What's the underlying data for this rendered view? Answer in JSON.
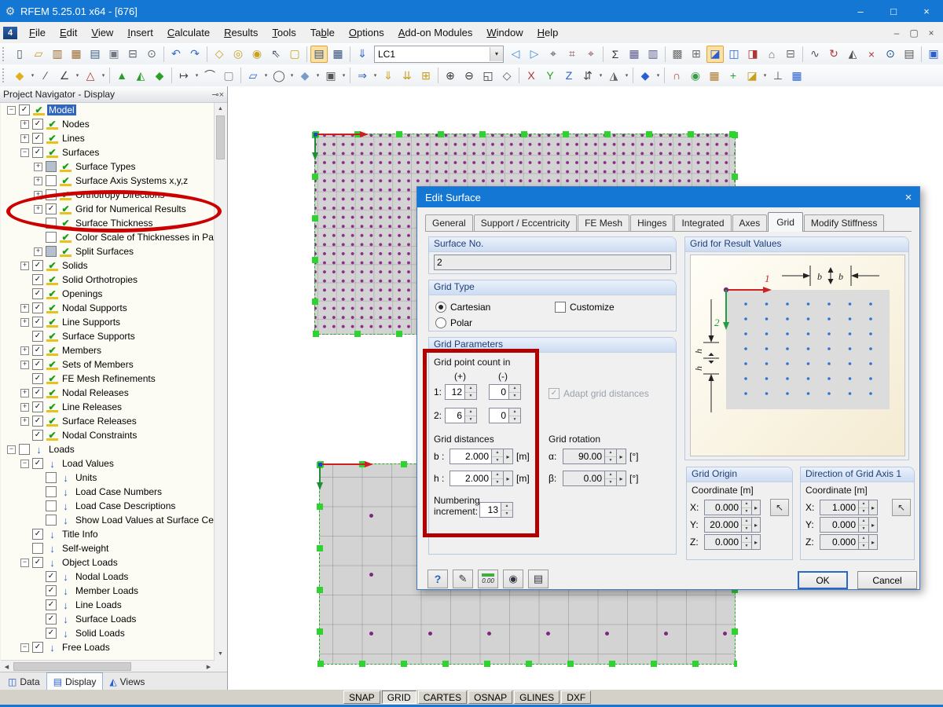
{
  "titlebar": {
    "title": "RFEM 5.25.01 x64 - [676]",
    "controls": [
      {
        "g": "–",
        "n": "minimize-button"
      },
      {
        "g": "□",
        "n": "maximize-button"
      },
      {
        "g": "×",
        "n": "close-button"
      }
    ]
  },
  "menubar": {
    "items": [
      {
        "label": "File",
        "u": 0
      },
      {
        "label": "Edit",
        "u": 0
      },
      {
        "label": "View",
        "u": 0
      },
      {
        "label": "Insert",
        "u": 0
      },
      {
        "label": "Calculate",
        "u": 0
      },
      {
        "label": "Results",
        "u": 0
      },
      {
        "label": "Tools",
        "u": 0
      },
      {
        "label": "Table",
        "u": 2
      },
      {
        "label": "Options",
        "u": 0
      },
      {
        "label": "Add-on Modules",
        "u": 0
      },
      {
        "label": "Window",
        "u": 0
      },
      {
        "label": "Help",
        "u": 0
      }
    ],
    "mdi_controls": [
      {
        "g": "–",
        "n": "mdi-minimize-button"
      },
      {
        "g": "▢",
        "n": "mdi-restore-button"
      },
      {
        "g": "×",
        "n": "mdi-close-button"
      }
    ]
  },
  "toolbar1": {
    "load_case": "LC1",
    "items_before": [
      "handle",
      [
        "▯",
        "new-file-icon",
        "#50565e"
      ],
      [
        "▱",
        "open-icon",
        "#c89a30"
      ],
      [
        "▥",
        "import-icon",
        "#9a6a30"
      ],
      [
        "▦",
        "export-icon",
        "#9a6a30"
      ],
      [
        "▤",
        "save-icon",
        "#3a5a86"
      ],
      [
        "▣",
        "clipboard-icon",
        "#707a86"
      ],
      [
        "⊟",
        "print-icon",
        "#5a6470"
      ],
      [
        "⊙",
        "print-preview-icon",
        "#5a6470"
      ],
      "sep",
      [
        "↶",
        "undo-icon",
        "#2f6cc4"
      ],
      [
        "↷",
        "redo-icon",
        "#2f6cc4"
      ],
      "sep",
      [
        "◇",
        "new-model-icon",
        "#c8a020"
      ],
      [
        "◎",
        "find-node-icon",
        "#c8a020"
      ],
      [
        "◉",
        "center-view-icon",
        "#c8a020"
      ],
      [
        "⇖",
        "selection-pointer-icon",
        "#4a5668"
      ],
      [
        "▢",
        "new-window-icon",
        "#c8a020"
      ],
      "sep",
      [
        "▤",
        "show-tables-icon",
        "#35507c",
        "hl"
      ],
      [
        "▦",
        "table-layout-icon",
        "#35507c"
      ],
      "sep",
      [
        "⇓",
        "load-case-icon",
        "#2b5fd0"
      ]
    ],
    "items_after": [
      [
        "◁",
        "previous-load-case-icon",
        "#3f84d8"
      ],
      [
        "▷",
        "next-load-case-icon",
        "#3f84d8"
      ],
      [
        "⌖",
        "move-node-icon",
        "#444444"
      ],
      [
        "⌗",
        "dimension-xx-icon",
        "#8a4a4a"
      ],
      [
        "⌖",
        "measure-icon",
        "#8a4a4a"
      ],
      "sep",
      [
        "Σ",
        "calculate-all-icon",
        "#333333"
      ],
      [
        "▦",
        "result-tables-icon",
        "#5a5a8c"
      ],
      [
        "▥",
        "printout-report-icon",
        "#5a5a8c"
      ],
      "sep",
      [
        "▩",
        "fe-mesh-icon",
        "#6a6a6a"
      ],
      [
        "⊞",
        "fe-mesh-settings-icon",
        "#6a6a6a"
      ],
      [
        "◪",
        "surface-grid-points-icon",
        "#2b5fd0",
        "hl"
      ],
      [
        "◫",
        "surface-axes-icon",
        "#2b5fd0"
      ],
      [
        "◨",
        "solid-grid-icon",
        "#b03636"
      ],
      [
        "⌂",
        "building-model-icon",
        "#6a6a6a"
      ],
      [
        "⊟",
        "visibilities-icon",
        "#6a6a6a"
      ],
      "sep",
      [
        "∿",
        "relations-icon",
        "#555555"
      ],
      [
        "↻",
        "regenerate-model-icon",
        "#b03636"
      ],
      [
        "◭",
        "mirror-icon",
        "#555555"
      ],
      [
        "×",
        "delete-results-icon",
        "#b03636"
      ],
      [
        "⊙",
        "object-info-icon",
        "#16508c"
      ],
      [
        "▤",
        "comments-icon",
        "#555555"
      ],
      "sep",
      [
        "▣",
        "add-on-module-icon",
        "#2b5fd0"
      ]
    ]
  },
  "toolbar2": {
    "items": [
      "handle",
      [
        "◆",
        "insert-node-icon",
        "#e0b020"
      ],
      "dd",
      [
        "∕",
        "insert-line-icon",
        "#444444"
      ],
      [
        "∠",
        "insert-polyline-icon",
        "#444444"
      ],
      "dd",
      [
        "△",
        "insert-member-icon",
        "#b03636"
      ],
      "dd",
      "sep",
      [
        "▲",
        "nodal-support-icon",
        "#2aa02a"
      ],
      [
        "◭",
        "line-support-icon",
        "#2aa02a"
      ],
      [
        "◆",
        "surface-support-icon",
        "#2aa02a"
      ],
      "sep",
      [
        "↦",
        "insert-dimension-icon",
        "#444444"
      ],
      "dd",
      [
        "⌒",
        "insert-arc-icon",
        "#444444"
      ],
      [
        "▢",
        "selection-window-icon",
        "#888888"
      ],
      "sep",
      [
        "▱",
        "insert-surface-icon",
        "#2b5fd0"
      ],
      "dd",
      [
        "◯",
        "insert-opening-icon",
        "#555555"
      ],
      "dd",
      [
        "◆",
        "insert-solid-icon",
        "#7a9cc8"
      ],
      "dd",
      [
        "▣",
        "copy-object-icon",
        "#555555"
      ],
      "dd",
      "sep",
      [
        "⇒",
        "connect-lines-icon",
        "#2b5fd0"
      ],
      "dd",
      [
        "⇓",
        "nodal-load-icon",
        "#c8a020"
      ],
      [
        "⇊",
        "member-load-icon",
        "#c8a020"
      ],
      [
        "⊞",
        "load-cases-icon",
        "#c8a020"
      ],
      "sep",
      [
        "⊕",
        "zoom-in-icon",
        "#333333"
      ],
      [
        "⊖",
        "zoom-out-icon",
        "#333333"
      ],
      [
        "◱",
        "zoom-window-icon",
        "#333333"
      ],
      [
        "◇",
        "isometric-view-icon",
        "#555566"
      ],
      "sep",
      [
        "X",
        "view-in-x-icon",
        "#b03636"
      ],
      [
        "Y",
        "view-in-y-icon",
        "#2aa02a"
      ],
      [
        "Z",
        "view-in-z-icon",
        "#2b5fd0"
      ],
      [
        "⇵",
        "flip-z-axis-icon",
        "#444444"
      ],
      "dd",
      [
        "◮",
        "work-plane-icon",
        "#666666"
      ],
      "dd",
      "sep",
      [
        "◆",
        "rendering-mode-icon",
        "#2b5fd0"
      ],
      "dd",
      "sep",
      [
        "∩",
        "results-deformation-icon",
        "#b04040"
      ],
      [
        "◉",
        "results-values-icon",
        "#3a9a4a"
      ],
      [
        "▦",
        "results-panel-icon",
        "#b07a30"
      ],
      [
        "+",
        "generate-loads-icon",
        "#2aa02a"
      ],
      [
        "◪",
        "color-panel-icon",
        "#c8a020"
      ],
      "dd",
      [
        "⊥",
        "section-icon",
        "#555555"
      ],
      [
        "▦",
        "color-scale-icon",
        "#2b5fd0"
      ]
    ]
  },
  "navigator": {
    "title": "Project Navigator - Display",
    "header_icons": [
      {
        "g": "⊸",
        "n": "auto-hide-pin-icon"
      },
      {
        "g": "×",
        "n": "close-panel-icon"
      }
    ],
    "icon_glyphs": {
      "check": "✔",
      "load": "↓"
    },
    "tree": [
      {
        "l": "Model",
        "lv": 0,
        "ic": "check",
        "ex": "minus",
        "ck": "on",
        "sel": true
      },
      {
        "l": "Nodes",
        "lv": 1,
        "ic": "check",
        "ex": "plus",
        "ck": "on"
      },
      {
        "l": "Lines",
        "lv": 1,
        "ic": "check",
        "ex": "plus",
        "ck": "on"
      },
      {
        "l": "Surfaces",
        "lv": 1,
        "ic": "check",
        "ex": "minus",
        "ck": "on"
      },
      {
        "l": "Surface Types",
        "lv": 2,
        "ic": "check",
        "ex": "plus",
        "ck": "p"
      },
      {
        "l": "Surface Axis Systems x,y,z",
        "lv": 2,
        "ic": "check",
        "ex": "plus",
        "ck": "off"
      },
      {
        "l": "Orthotropy Directions",
        "lv": 2,
        "ic": "check",
        "ex": "plus",
        "ck": "off"
      },
      {
        "l": "Grid for Numerical Results",
        "lv": 2,
        "ic": "check",
        "ex": "plus",
        "ck": "on"
      },
      {
        "l": "Surface Thickness",
        "lv": 2,
        "ic": "check",
        "ck": "off"
      },
      {
        "l": "Color Scale of Thicknesses in Pa",
        "lv": 2,
        "ic": "check",
        "ck": "off"
      },
      {
        "l": "Split Surfaces",
        "lv": 2,
        "ic": "check",
        "ex": "plus",
        "ck": "p"
      },
      {
        "l": "Solids",
        "lv": 1,
        "ic": "check",
        "ex": "plus",
        "ck": "on"
      },
      {
        "l": "Solid Orthotropies",
        "lv": 1,
        "ic": "check",
        "ck": "on"
      },
      {
        "l": "Openings",
        "lv": 1,
        "ic": "check",
        "ck": "on"
      },
      {
        "l": "Nodal Supports",
        "lv": 1,
        "ic": "check",
        "ex": "plus",
        "ck": "on"
      },
      {
        "l": "Line Supports",
        "lv": 1,
        "ic": "check",
        "ex": "plus",
        "ck": "on"
      },
      {
        "l": "Surface Supports",
        "lv": 1,
        "ic": "check",
        "ck": "on"
      },
      {
        "l": "Members",
        "lv": 1,
        "ic": "check",
        "ex": "plus",
        "ck": "on"
      },
      {
        "l": "Sets of Members",
        "lv": 1,
        "ic": "check",
        "ex": "plus",
        "ck": "on"
      },
      {
        "l": "FE Mesh Refinements",
        "lv": 1,
        "ic": "check",
        "ck": "on"
      },
      {
        "l": "Nodal Releases",
        "lv": 1,
        "ic": "check",
        "ex": "plus",
        "ck": "on"
      },
      {
        "l": "Line Releases",
        "lv": 1,
        "ic": "check",
        "ex": "plus",
        "ck": "on"
      },
      {
        "l": "Surface Releases",
        "lv": 1,
        "ic": "check",
        "ex": "plus",
        "ck": "on"
      },
      {
        "l": "Nodal Constraints",
        "lv": 1,
        "ic": "check",
        "ck": "on"
      },
      {
        "l": "Loads",
        "lv": 0,
        "ic": "load",
        "ex": "minus",
        "ck": "off"
      },
      {
        "l": "Load Values",
        "lv": 1,
        "ic": "load",
        "ex": "minus",
        "ck": "on"
      },
      {
        "l": "Units",
        "lv": 2,
        "ic": "load",
        "ck": "off"
      },
      {
        "l": "Load Case Numbers",
        "lv": 2,
        "ic": "load",
        "ck": "off"
      },
      {
        "l": "Load Case Descriptions",
        "lv": 2,
        "ic": "load",
        "ck": "off"
      },
      {
        "l": "Show Load Values at Surface Ce",
        "lv": 2,
        "ic": "load",
        "ck": "off"
      },
      {
        "l": "Title Info",
        "lv": 1,
        "ic": "load",
        "ck": "on"
      },
      {
        "l": "Self-weight",
        "lv": 1,
        "ic": "load",
        "ck": "off"
      },
      {
        "l": "Object Loads",
        "lv": 1,
        "ic": "load",
        "ex": "minus",
        "ck": "on"
      },
      {
        "l": "Nodal Loads",
        "lv": 2,
        "ic": "load",
        "ck": "on"
      },
      {
        "l": "Member Loads",
        "lv": 2,
        "ic": "load",
        "ck": "on"
      },
      {
        "l": "Line Loads",
        "lv": 2,
        "ic": "load",
        "ck": "on"
      },
      {
        "l": "Surface Loads",
        "lv": 2,
        "ic": "load",
        "ck": "on"
      },
      {
        "l": "Solid Loads",
        "lv": 2,
        "ic": "load",
        "ck": "on"
      },
      {
        "l": "Free Loads",
        "lv": 1,
        "ic": "load",
        "ex": "minus",
        "ck": "on"
      }
    ],
    "tabs": [
      {
        "label": "Data",
        "icon": "◫"
      },
      {
        "label": "Display",
        "icon": "▤",
        "active": true
      },
      {
        "label": "Views",
        "icon": "◭"
      }
    ]
  },
  "dialog": {
    "title": "Edit Surface",
    "tabs": [
      {
        "label": "General"
      },
      {
        "label": "Support / Eccentricity"
      },
      {
        "label": "FE Mesh"
      },
      {
        "label": "Hinges"
      },
      {
        "label": "Integrated"
      },
      {
        "label": "Axes"
      },
      {
        "label": "Grid",
        "active": true
      },
      {
        "label": "Modify Stiffness"
      }
    ],
    "surface_no": {
      "header": "Surface No.",
      "value": "2"
    },
    "grid_type": {
      "header": "Grid Type",
      "cartesian": "Cartesian",
      "polar": "Polar",
      "customize": "Customize"
    },
    "grid_params": {
      "header": "Grid Parameters",
      "count_label": "Grid point count in",
      "plus": "(+)",
      "minus": "(-)",
      "row1_label": "1:",
      "row1_plus": "12",
      "row1_minus": "0",
      "row2_label": "2:",
      "row2_plus": "6",
      "row2_minus": "0",
      "adapt": "Adapt grid distances",
      "distances_label": "Grid distances",
      "b_label": "b :",
      "b_value": "2.000",
      "b_unit": "[m]",
      "h_label": "h :",
      "h_value": "2.000",
      "h_unit": "[m]",
      "rotation_label": "Grid rotation",
      "alpha_label": "α:",
      "alpha_value": "90.00",
      "alpha_unit": "[°]",
      "beta_label": "β:",
      "beta_value": "0.00",
      "beta_unit": "[°]",
      "numbering_label": "Numbering increment:",
      "numbering_value": "13"
    },
    "preview": {
      "header": "Grid for Result Values",
      "axis1": "1",
      "axis2": "2",
      "b": "b",
      "h": "h"
    },
    "grid_origin": {
      "header": "Grid Origin",
      "coord_label": "Coordinate [m]",
      "x_label": "X:",
      "x": "0.000",
      "y_label": "Y:",
      "y": "20.000",
      "z_label": "Z:",
      "z": "0.000"
    },
    "grid_axis_dir": {
      "header": "Direction of Grid Axis 1",
      "coord_label": "Coordinate [m]",
      "x_label": "X:",
      "x": "1.000",
      "y_label": "Y:",
      "y": "0.000",
      "z_label": "Z:",
      "z": "0.000"
    },
    "tool_buttons": [
      {
        "g": "?",
        "n": "help-button",
        "cls": "help"
      },
      {
        "g": "✎",
        "n": "edit-comment-button"
      },
      {
        "g": "0.00",
        "n": "units-decimal-places-button",
        "cls": "units"
      },
      {
        "g": "◉",
        "n": "view-surface-button"
      },
      {
        "g": "▤",
        "n": "apply-to-other-surfaces-button"
      }
    ],
    "ok": "OK",
    "cancel": "Cancel"
  },
  "statusbar": {
    "buttons": [
      {
        "label": "SNAP"
      },
      {
        "label": "GRID",
        "pressed": true
      },
      {
        "label": "CARTES"
      },
      {
        "label": "OSNAP"
      },
      {
        "label": "GLINES"
      },
      {
        "label": "DXF"
      }
    ]
  }
}
